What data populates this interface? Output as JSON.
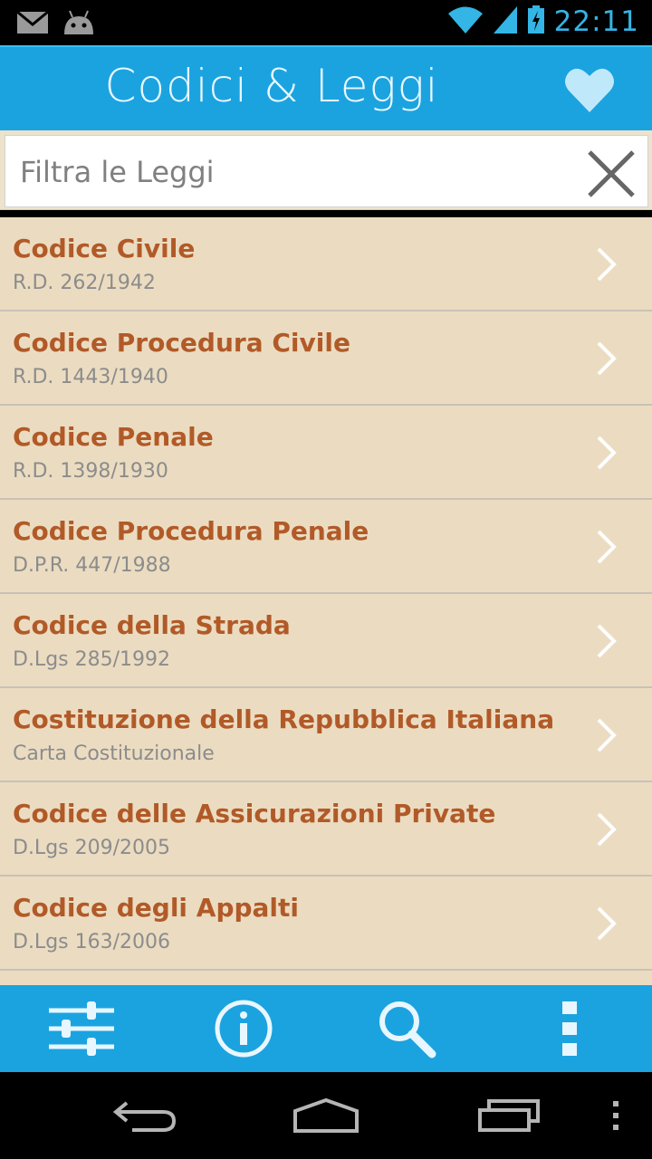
{
  "status_bar": {
    "time": "22:11",
    "icons": [
      "mail-icon",
      "android-icon",
      "wifi-icon",
      "signal-icon",
      "battery-charging-icon"
    ]
  },
  "header": {
    "title": "Codici & Leggi",
    "favorite_icon": "heart-icon"
  },
  "search": {
    "placeholder": "Filtra le Leggi",
    "value": "",
    "clear_icon": "close-icon"
  },
  "laws": [
    {
      "title": "Codice Civile",
      "subtitle": "R.D. 262/1942"
    },
    {
      "title": "Codice Procedura Civile",
      "subtitle": "R.D. 1443/1940"
    },
    {
      "title": "Codice Penale",
      "subtitle": "R.D. 1398/1930"
    },
    {
      "title": "Codice Procedura Penale",
      "subtitle": "D.P.R. 447/1988"
    },
    {
      "title": "Codice della Strada",
      "subtitle": "D.Lgs 285/1992"
    },
    {
      "title": "Costituzione della Repubblica Italiana",
      "subtitle": "Carta Costituzionale"
    },
    {
      "title": "Codice delle Assicurazioni Private",
      "subtitle": "D.Lgs 209/2005"
    },
    {
      "title": "Codice degli Appalti",
      "subtitle": "D.Lgs 163/2006"
    }
  ],
  "toolbar": {
    "items": [
      "settings-sliders-icon",
      "info-icon",
      "search-icon",
      "overflow-menu-icon"
    ]
  },
  "navigation": {
    "items": [
      "back-icon",
      "home-icon",
      "recent-apps-icon",
      "menu-icon"
    ]
  },
  "colors": {
    "accent": "#1ba3e0",
    "list_background": "#ebdcc1",
    "item_title": "#b15a28",
    "item_subtitle": "#8c8c8c",
    "clock": "#33b5e5"
  }
}
